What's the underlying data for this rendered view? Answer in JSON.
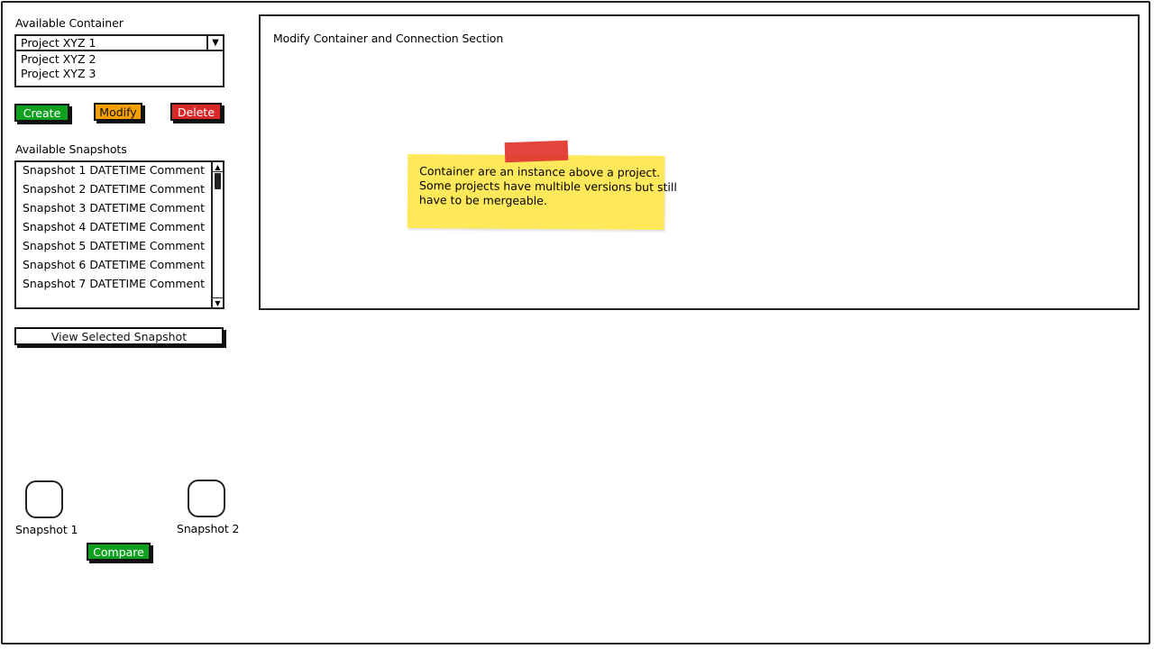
{
  "container": {
    "label": "Available Container",
    "selected": "Project XYZ 1",
    "options": [
      "Project XYZ 2",
      "Project XYZ 3"
    ]
  },
  "actions": {
    "create": "Create",
    "modify": "Modify",
    "delete": "Delete"
  },
  "snapshots": {
    "label": "Available Snapshots",
    "items": [
      "Snapshot 1 DATETIME Comment",
      "Snapshot 2 DATETIME Comment",
      "Snapshot 3 DATETIME Comment",
      "Snapshot 4 DATETIME Comment",
      "Snapshot 5 DATETIME Comment",
      "Snapshot 6 DATETIME Comment",
      "Snapshot 7 DATETIME Comment"
    ],
    "view_button": "View Selected Snapshot"
  },
  "panel": {
    "title": "Modify Container and Connection Section"
  },
  "note": {
    "lines": [
      "Container are an instance above a project.",
      "Some projects have multible versions but still",
      "have to be mergeable."
    ]
  },
  "compare": {
    "slot1_label": "Snapshot 1",
    "slot2_label": "Snapshot 2",
    "button": "Compare"
  },
  "colors": {
    "green": "#10a020",
    "orange": "#f5a000",
    "red": "#d82828",
    "sticky": "#ffe95a",
    "tape": "#e23a32"
  },
  "icons": {
    "dropdown": "chevron-down-icon",
    "scroll_up": "arrow-up-icon",
    "scroll_down": "arrow-down-icon"
  }
}
